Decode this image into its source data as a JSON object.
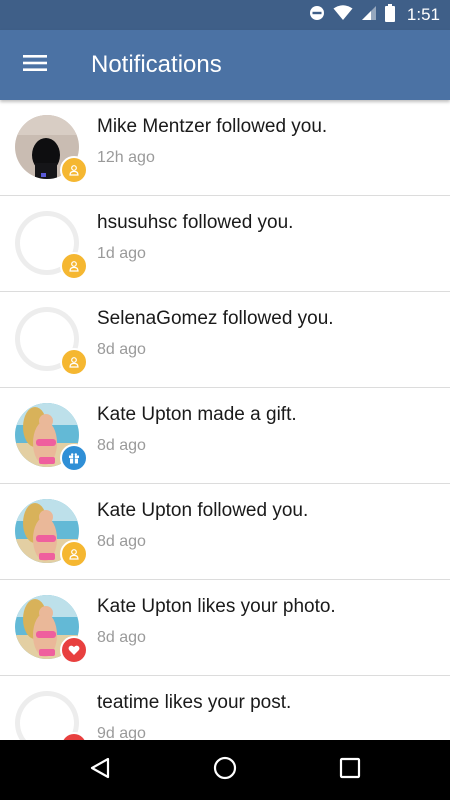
{
  "status_bar": {
    "time": "1:51",
    "icons": [
      "do-not-disturb-icon",
      "wifi-icon",
      "signal-icon",
      "battery-icon"
    ]
  },
  "app_bar": {
    "title": "Notifications",
    "menu_icon": "hamburger-menu-icon"
  },
  "colors": {
    "status_bar": "#3f5f88",
    "app_bar": "#4b72a4",
    "follow_badge": "#f5b731",
    "gift_badge": "#2f8fd6",
    "like_badge": "#e8403f"
  },
  "notifications": [
    {
      "text": "Mike Mentzer followed you.",
      "time": "12h ago",
      "type": "follow",
      "avatar": "photo-dark"
    },
    {
      "text": "hsusuhsc followed you.",
      "time": "1d ago",
      "type": "follow",
      "avatar": "placeholder"
    },
    {
      "text": "SelenaGomez followed you.",
      "time": "8d ago",
      "type": "follow",
      "avatar": "placeholder"
    },
    {
      "text": "Kate Upton made a gift.",
      "time": "8d ago",
      "type": "gift",
      "avatar": "photo-beach"
    },
    {
      "text": "Kate Upton followed you.",
      "time": "8d ago",
      "type": "follow",
      "avatar": "photo-beach"
    },
    {
      "text": "Kate Upton likes your photo.",
      "time": "8d ago",
      "type": "like",
      "avatar": "photo-beach"
    },
    {
      "text": "teatime likes your post.",
      "time": "9d ago",
      "type": "like",
      "avatar": "placeholder"
    }
  ],
  "nav_bar": {
    "icons": [
      "back-icon",
      "home-icon",
      "recents-icon"
    ]
  }
}
